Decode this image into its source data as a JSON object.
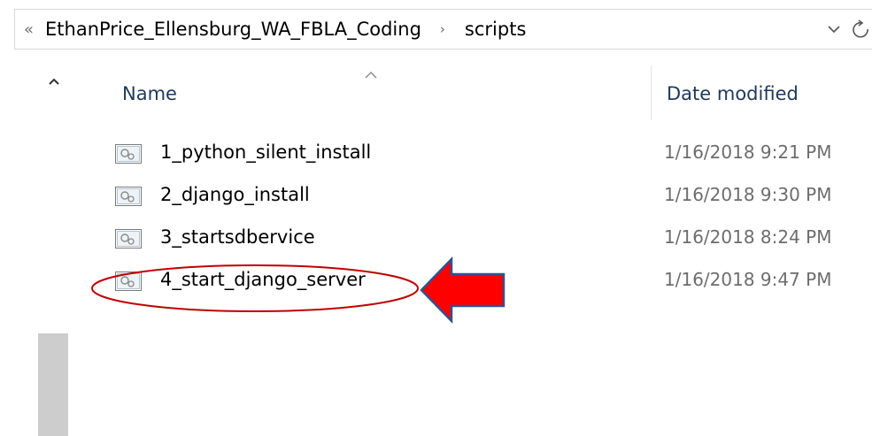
{
  "address_bar": {
    "overflow_glyph": "«",
    "crumbs": [
      "EthanPrice_Ellensburg_WA_FBLA_Coding",
      "scripts"
    ],
    "separator_glyph": "›"
  },
  "columns": {
    "name": "Name",
    "date_modified": "Date modified",
    "sort_direction": "ascending"
  },
  "files": [
    {
      "name": "1_python_silent_install",
      "date_modified": "1/16/2018 9:21 PM",
      "type_icon": "script-file-icon"
    },
    {
      "name": "2_django_install",
      "date_modified": "1/16/2018 9:30 PM",
      "type_icon": "script-file-icon"
    },
    {
      "name": "3_startsdbervice",
      "date_modified": "1/16/2018 8:24 PM",
      "type_icon": "script-file-icon"
    },
    {
      "name": "4_start_django_server",
      "date_modified": "1/16/2018 9:47 PM",
      "type_icon": "script-file-icon"
    }
  ],
  "annotation": {
    "highlighted_file": "4_start_django_server",
    "color": "#c00000",
    "arrow_fill": "#ff0000",
    "arrow_outline": "#2f528f"
  },
  "colors": {
    "header_text": "#1e395b",
    "date_text": "#6d6d6d",
    "scrollbar_thumb": "#cdcdcd"
  }
}
